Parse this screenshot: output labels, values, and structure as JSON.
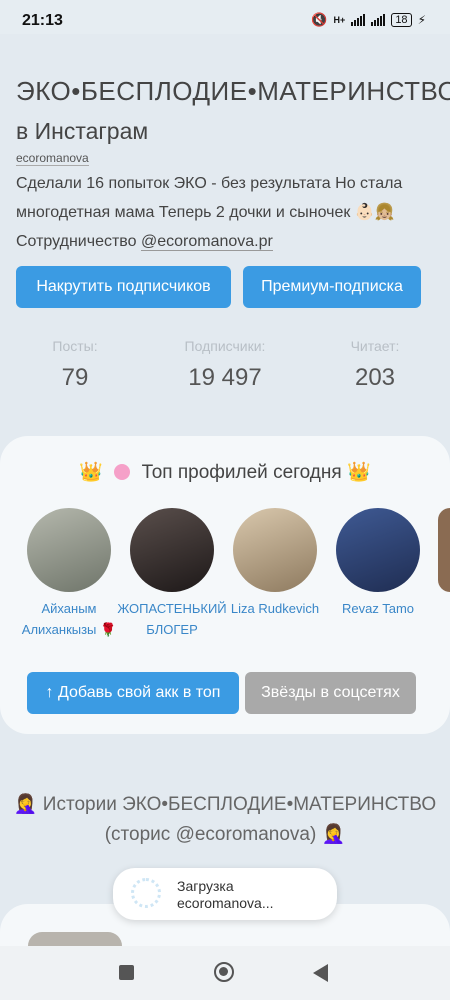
{
  "status_bar": {
    "time": "21:13",
    "network": "H+",
    "battery": "18"
  },
  "header": {
    "title": "ЭКО•БЕСПЛОДИЕ•МАТЕРИНСТВО",
    "subtitle": "в Инстаграм",
    "handle": "ecoromanova",
    "bio_line1": "Сделали 16 попыток ЭКО - без результата Но стала многодетная мама Теперь 2 дочки и сыночек 👶🏻👧🏼",
    "bio_collab_prefix": "Сотрудничество",
    "bio_collab_link": "@ecoromanova.pr"
  },
  "actions": {
    "boost_followers": "Накрутить подписчиков",
    "premium": "Премиум-подписка"
  },
  "stats": [
    {
      "label": "Посты:",
      "value": "79"
    },
    {
      "label": "Подписчики:",
      "value": "19 497"
    },
    {
      "label": "Читает:",
      "value": "203"
    }
  ],
  "top_profiles": {
    "title": "Топ профилей сегодня",
    "crown_icon": "👑",
    "profiles": [
      {
        "name": "Айханым Алиханкызы 🌹",
        "color": "#8a8f82"
      },
      {
        "name": "ЖОПАСТЕНЬКИЙ БЛОГЕР",
        "color": "#3a3433"
      },
      {
        "name": "Liza Rudkevich",
        "color": "#c9b79c"
      },
      {
        "name": "Revaz Tamo",
        "color": "#2c3f6e"
      }
    ],
    "add_button": "↑ Добавь свой акк в топ",
    "stars_button": "Звёзды в соцсетях"
  },
  "stories": {
    "text": "🤦‍♀️ Истории ЭКО•БЕСПЛОДИЕ•МАТЕРИНСТВО (сторис @ecoromanova) 🤦‍♀️"
  },
  "toast": {
    "line1": "Загрузка",
    "line2": "ecoromanova..."
  }
}
